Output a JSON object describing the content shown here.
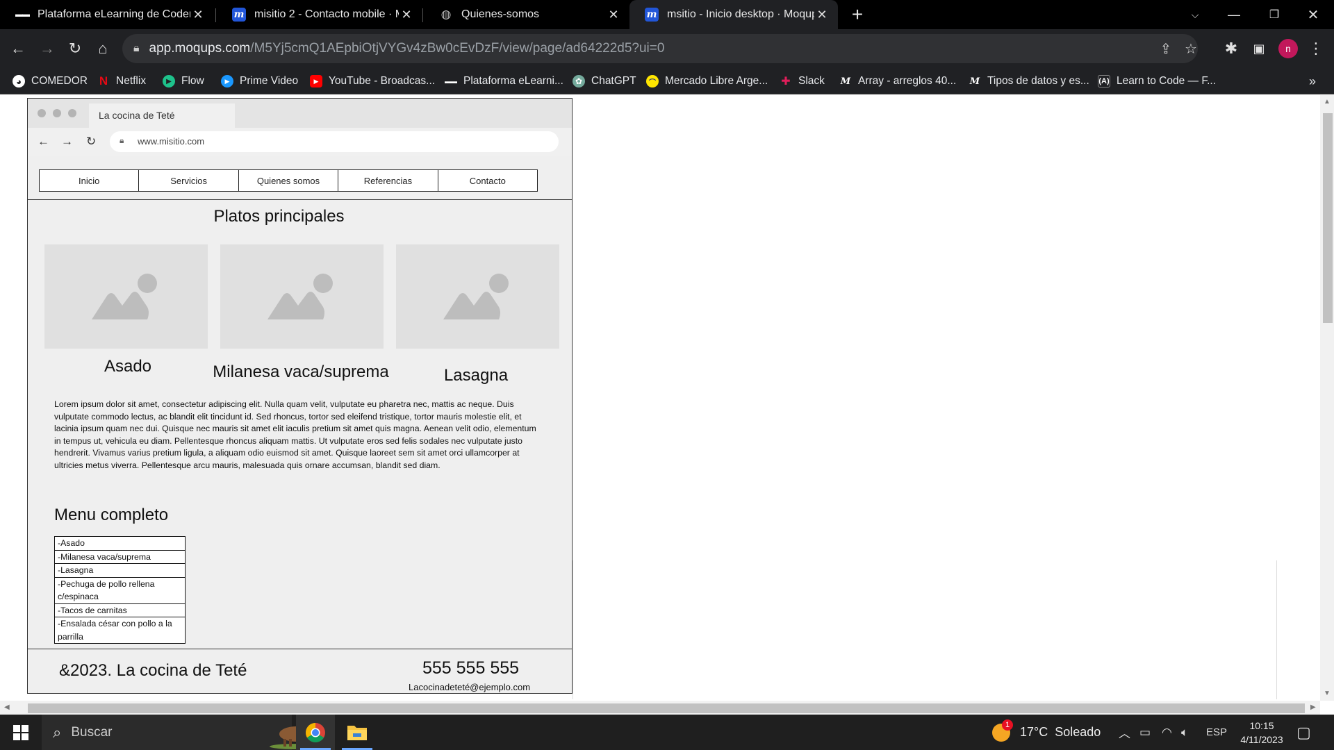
{
  "browser": {
    "tabs": [
      {
        "title": "Plataforma eLearning de Coderhouse",
        "icon": "coderhouse-icon",
        "active": false
      },
      {
        "title": "misitio 2 - Contacto mobile · Moqups",
        "icon": "moqups-icon",
        "active": false
      },
      {
        "title": "Quienes-somos",
        "icon": "globe-icon",
        "active": false
      },
      {
        "title": "msitio - Inicio desktop · Moqups",
        "icon": "moqups-icon",
        "active": true
      }
    ],
    "new_tab": "+",
    "url_host": "app.moqups.com",
    "url_path": "/M5Yj5cmQ1AEpbiOtjVYGv4zBw0cEvDzF/view/page/ad64222d5?ui=0",
    "profile_initial": "n",
    "bookmarks": [
      {
        "label": "COMEDOR",
        "icon": "chrome-icon"
      },
      {
        "label": "Netflix",
        "icon": "netflix-icon"
      },
      {
        "label": "Flow",
        "icon": "flow-icon"
      },
      {
        "label": "Prime Video",
        "icon": "prime-video-icon"
      },
      {
        "label": "YouTube - Broadcas...",
        "icon": "youtube-icon"
      },
      {
        "label": "Plataforma eLearni...",
        "icon": "coderhouse-icon"
      },
      {
        "label": "ChatGPT",
        "icon": "chatgpt-icon"
      },
      {
        "label": "Mercado Libre Arge...",
        "icon": "mercadolibre-icon"
      },
      {
        "label": "Slack",
        "icon": "slack-icon"
      },
      {
        "label": "Array - arreglos 40...",
        "icon": "moqups-m-icon"
      },
      {
        "label": "Tipos de datos y es...",
        "icon": "moqups-m-icon"
      },
      {
        "label": "Learn to Code — F...",
        "icon": "freecodecamp-icon"
      }
    ],
    "more_bookmarks": "»"
  },
  "mockup": {
    "tab_title": "La cocina de Teté",
    "url": "www.misitio.com",
    "nav": [
      "Inicio",
      "Servicios",
      "Quienes somos",
      "Referencias",
      "Contacto"
    ],
    "section_title": "Platos principales",
    "dishes": [
      "Asado",
      "Milanesa vaca/suprema",
      "Lasagna"
    ],
    "lorem": "Lorem ipsum dolor sit amet, consectetur adipiscing elit. Nulla quam velit, vulputate eu pharetra nec, mattis ac neque. Duis vulputate commodo lectus, ac blandit elit tincidunt id. Sed rhoncus, tortor sed eleifend tristique, tortor mauris molestie elit, et lacinia ipsum quam nec dui. Quisque nec mauris sit amet elit iaculis pretium sit amet quis magna. Aenean velit odio, elementum in tempus ut, vehicula eu diam. Pellentesque rhoncus aliquam mattis. Ut vulputate eros sed felis sodales nec vulputate justo hendrerit. Vivamus varius pretium ligula, a aliquam odio euismod sit amet. Quisque laoreet sem sit amet orci ullamcorper at ultricies metus viverra. Pellentesque arcu mauris, malesuada quis ornare accumsan, blandit sed diam.",
    "menu_title": "Menu completo",
    "menu_items": [
      "-Asado",
      "-Milanesa vaca/suprema",
      "-Lasagna",
      "-Pechuga de pollo rellena c/espinaca",
      "-Tacos de carnitas",
      "-Ensalada césar con pollo a la parrilla"
    ],
    "footer_copy": "&2023. La cocina de Teté",
    "footer_phone": "555 555 555",
    "footer_email": "Lacocinadeteté@ejemplo.com"
  },
  "taskbar": {
    "search_placeholder": "Buscar",
    "weather_temp": "17°C",
    "weather_desc": "Soleado",
    "weather_badge": "1",
    "language": "ESP",
    "time": "10:15",
    "date": "4/11/2023"
  }
}
